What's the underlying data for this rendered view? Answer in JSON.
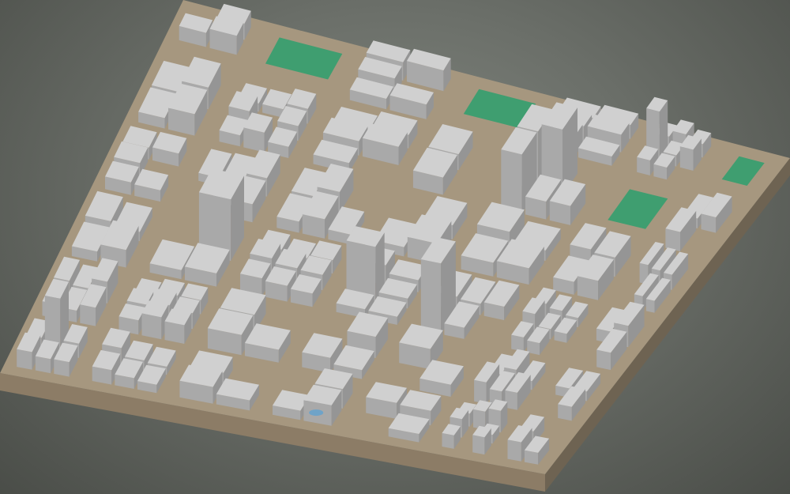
{
  "scene": {
    "subject": "3d-city-block-model",
    "colors": {
      "background_center": "#828780",
      "background_edge": "#4a4d48",
      "ground": "#a6977f",
      "base_side_front": "#8c7c66",
      "base_side_right": "#6e6352",
      "building_top": "#d0d0d0",
      "building_left": "#a9a9a9",
      "building_right": "#959595",
      "park": "#3f9e70",
      "water": "#6fa3c8"
    }
  }
}
